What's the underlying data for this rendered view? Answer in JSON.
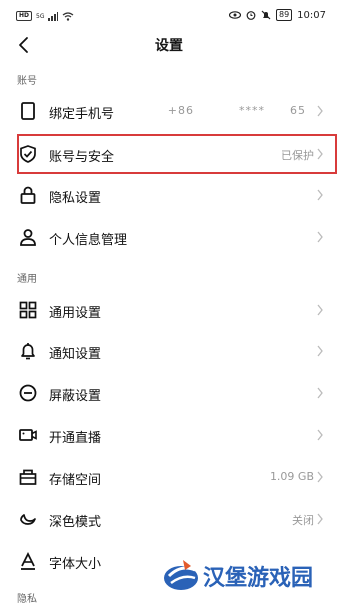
{
  "status_bar": {
    "network": "HD",
    "signal": "5G",
    "battery": "89",
    "time": "10:07"
  },
  "header": {
    "title": "设置"
  },
  "sections": {
    "account": "账号",
    "general": "通用",
    "privacy_partial": "隐私"
  },
  "rows": {
    "bind_phone": {
      "label": "绑定手机号",
      "value_prefix": "+86",
      "value_mask": "****",
      "value_suffix": "65",
      "icon": "phone-icon"
    },
    "account_security": {
      "label": "账号与安全",
      "value": "已保护",
      "icon": "shield-check-icon"
    },
    "privacy_settings": {
      "label": "隐私设置",
      "value": "",
      "icon": "lock-icon"
    },
    "personal_info": {
      "label": "个人信息管理",
      "value": "",
      "icon": "person-icon"
    },
    "general_settings": {
      "label": "通用设置",
      "value": "",
      "icon": "grid-icon"
    },
    "notification_settings": {
      "label": "通知设置",
      "value": "",
      "icon": "bell-icon"
    },
    "block_settings": {
      "label": "屏蔽设置",
      "value": "",
      "icon": "block-icon"
    },
    "live_stream": {
      "label": "开通直播",
      "value": "",
      "icon": "video-icon"
    },
    "storage": {
      "label": "存储空间",
      "value": "1.09 GB",
      "icon": "storage-box-icon"
    },
    "dark_mode": {
      "label": "深色模式",
      "value": "关闭",
      "icon": "moon-icon"
    },
    "font_size": {
      "label": "字体大小",
      "value": "",
      "icon": "font-size-icon"
    }
  },
  "watermark": {
    "text": "汉堡游戏园"
  },
  "colors": {
    "highlight": "#d83b3b",
    "watermark": "#2a62b7"
  }
}
